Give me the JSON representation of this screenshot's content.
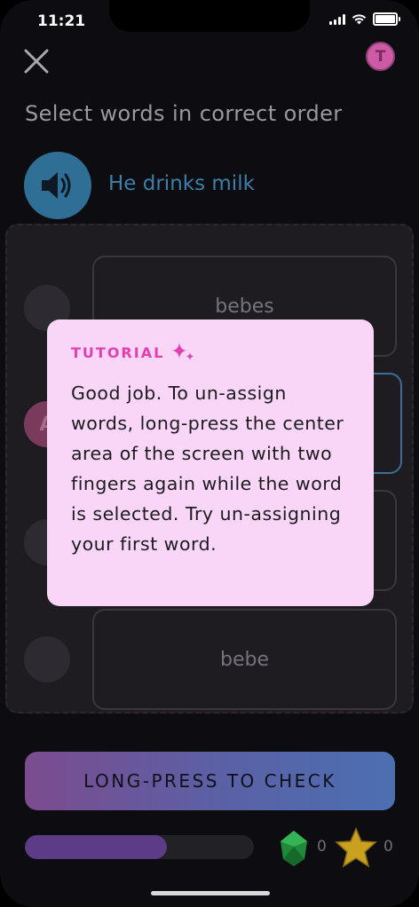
{
  "status_bar": {
    "time": "11:21"
  },
  "header": {
    "avatar_initial": "T"
  },
  "exercise": {
    "instruction": "Select words in correct order",
    "prompt": "He drinks milk"
  },
  "answers": {
    "cards": [
      "bebes",
      "",
      "",
      "bebe"
    ],
    "assigned_slot_label": "A"
  },
  "tutorial": {
    "title": "TUTORIAL",
    "body": "Good job. To un-assign words, long-press the center area of the screen with two fingers again while the word is selected. Try un-assigning your first word."
  },
  "actions": {
    "check_label": "LONG-PRESS TO CHECK"
  },
  "footer": {
    "progress": 0.62,
    "gems": "0",
    "stars": "0"
  },
  "colors": {
    "accent_pink": "#e040b0",
    "tooltip_bg": "#f9d6f8",
    "progress_fill": "#5c3c86"
  }
}
